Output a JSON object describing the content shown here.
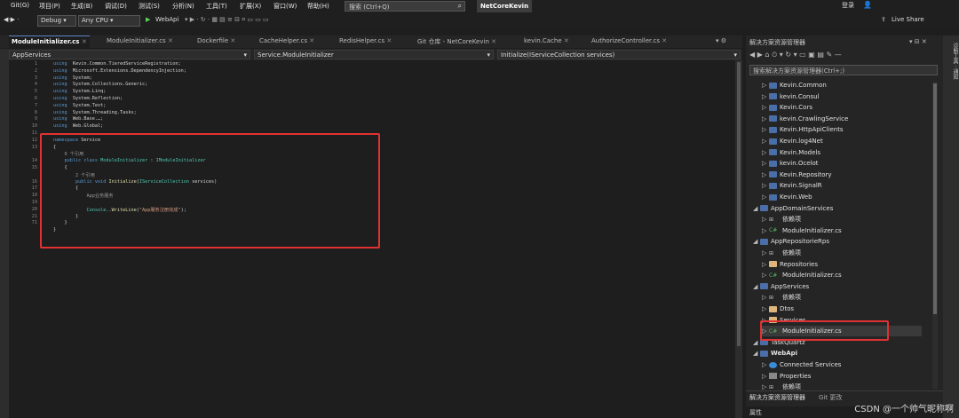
{
  "menu": {
    "items": [
      "Git(G)",
      "项目(P)",
      "生成(B)",
      "调试(D)",
      "测试(S)",
      "分析(N)",
      "工具(T)",
      "扩展(X)",
      "窗口(W)",
      "帮助(H)"
    ],
    "search_placeholder": "搜索 (Ctrl+Q)",
    "solution_name": "NetCoreKevin",
    "login": "登录",
    "live_share": "Live Share"
  },
  "toolbar": {
    "config": "Debug",
    "platform": "Any CPU",
    "run_target": "WebApi"
  },
  "tabs": [
    "ModuleInitializer.cs",
    "ModuleInitializer.cs",
    "Dockerfile",
    "CacheHelper.cs",
    "RedisHelper.cs",
    "Git 仓库 - NetCoreKevin",
    "kevin.Cache",
    "AuthorizeController.cs"
  ],
  "nav": {
    "project": "AppServices",
    "class": "Service.ModuleInitializer",
    "member": "Initialize(IServiceCollection services)"
  },
  "editor": {
    "lines": [
      "1",
      "2",
      "3",
      "4",
      "5",
      "6",
      "7",
      "8",
      "9",
      "10",
      "11",
      "12",
      "13",
      "",
      "14",
      "15",
      "",
      "16",
      "17",
      "18",
      "19",
      "20",
      "21",
      "71"
    ],
    "code": [
      [
        [
          "k",
          "using"
        ],
        [
          "",
          "  Kevin.Common.TieredServiceRegistration;"
        ]
      ],
      [
        [
          "k",
          "using"
        ],
        [
          "",
          "  Microsoft.Extensions.DependencyInjection;"
        ]
      ],
      [
        [
          "k",
          "using"
        ],
        [
          "",
          "  System;"
        ]
      ],
      [
        [
          "k",
          "using"
        ],
        [
          "",
          "  System.Collections.Generic;"
        ]
      ],
      [
        [
          "k",
          "using"
        ],
        [
          "",
          "  System.Linq;"
        ]
      ],
      [
        [
          "k",
          "using"
        ],
        [
          "",
          "  System.Reflection;"
        ]
      ],
      [
        [
          "k",
          "using"
        ],
        [
          "",
          "  System.Text;"
        ]
      ],
      [
        [
          "k",
          "using"
        ],
        [
          "",
          "  System.Threading.Tasks;"
        ]
      ],
      [
        [
          "k",
          "using"
        ],
        [
          "",
          "  Web.Base.…;"
        ]
      ],
      [
        [
          "k",
          "using"
        ],
        [
          "",
          "  Web.Global;"
        ]
      ],
      [
        [
          "",
          ""
        ]
      ],
      [
        [
          "k",
          "namespace"
        ],
        [
          "",
          " Service"
        ]
      ],
      [
        [
          "",
          "{"
        ]
      ],
      [
        [
          "c",
          "    0 个引用"
        ]
      ],
      [
        [
          "k",
          "    public class"
        ],
        [
          "t",
          " ModuleInitializer"
        ],
        [
          "",
          " : "
        ],
        [
          "t",
          "IModuleInitializer"
        ]
      ],
      [
        [
          "",
          "    {"
        ]
      ],
      [
        [
          "c",
          "        2 个引用"
        ]
      ],
      [
        [
          "k",
          "        public void"
        ],
        [
          "m",
          " Initialize"
        ],
        [
          "",
          "("
        ],
        [
          "t",
          "IServiceCollection"
        ],
        [
          "",
          " services)"
        ]
      ],
      [
        [
          "",
          "        {"
        ]
      ],
      [
        [
          "c",
          "            App业务服务"
        ]
      ],
      [
        [
          "",
          ""
        ]
      ],
      [
        [
          "",
          "            "
        ],
        [
          "t",
          "Console"
        ],
        [
          ".",
          ""
        ],
        [
          "m",
          ".WriteLine"
        ],
        [
          "",
          "("
        ],
        [
          "s",
          "\"App服务注册完成\""
        ],
        [
          ");",
          ""
        ]
      ],
      [
        [
          "",
          "        }"
        ]
      ],
      [
        [
          "",
          "    }"
        ]
      ],
      [
        [
          "",
          "}"
        ]
      ]
    ]
  },
  "solution_explorer": {
    "title": "解决方案资源管理器",
    "search_placeholder": "搜索解决方案资源管理器(Ctrl+;)",
    "items": [
      {
        "label": "Kevin.Common",
        "type": "proj",
        "indent": 1
      },
      {
        "label": "kevin.Consul",
        "type": "proj",
        "indent": 1
      },
      {
        "label": "Kevin.Cors",
        "type": "proj",
        "indent": 1
      },
      {
        "label": "kevin.CrawlingService",
        "type": "proj",
        "indent": 1
      },
      {
        "label": "Kevin.HttpApiClients",
        "type": "proj",
        "indent": 1
      },
      {
        "label": "Kevin.log4Net",
        "type": "proj",
        "indent": 1
      },
      {
        "label": "Kevin.Models",
        "type": "proj",
        "indent": 1
      },
      {
        "label": "kevin.Ocelot",
        "type": "proj",
        "indent": 1
      },
      {
        "label": "Kevin.Repository",
        "type": "proj",
        "indent": 1
      },
      {
        "label": "Kevin.SignalR",
        "type": "proj",
        "indent": 1
      },
      {
        "label": "Kevin.Web",
        "type": "proj",
        "indent": 1
      },
      {
        "label": "AppDomainServices",
        "type": "proj",
        "indent": 0
      },
      {
        "label": "依赖项",
        "type": "dep",
        "indent": 1
      },
      {
        "label": "ModuleInitializer.cs",
        "type": "cs",
        "indent": 1
      },
      {
        "label": "AppRepositorieRps",
        "type": "proj",
        "indent": 0
      },
      {
        "label": "依赖项",
        "type": "dep",
        "indent": 1
      },
      {
        "label": "Repositories",
        "type": "folder",
        "indent": 1
      },
      {
        "label": "ModuleInitializer.cs",
        "type": "cs",
        "indent": 1
      },
      {
        "label": "AppServices",
        "type": "proj",
        "indent": 0
      },
      {
        "label": "依赖项",
        "type": "dep",
        "indent": 1
      },
      {
        "label": "Dtos",
        "type": "folder",
        "indent": 1
      },
      {
        "label": "Services",
        "type": "folder",
        "indent": 1
      },
      {
        "label": "ModuleInitializer.cs",
        "type": "cs",
        "indent": 1,
        "selected": true
      },
      {
        "label": "TaskQuartz",
        "type": "proj",
        "indent": 0
      },
      {
        "label": "WebApi",
        "type": "proj",
        "indent": 0,
        "bold": true
      },
      {
        "label": "Connected Services",
        "type": "svc",
        "indent": 1
      },
      {
        "label": "Properties",
        "type": "wrench",
        "indent": 1
      },
      {
        "label": "依赖项",
        "type": "dep",
        "indent": 1
      }
    ],
    "bottom_tabs": [
      "解决方案资源管理器",
      "Git 更改"
    ],
    "properties": "属性"
  },
  "right_strip": "诊断工具 · 通知",
  "watermark": "CSDN @一个帅气昵称啊"
}
